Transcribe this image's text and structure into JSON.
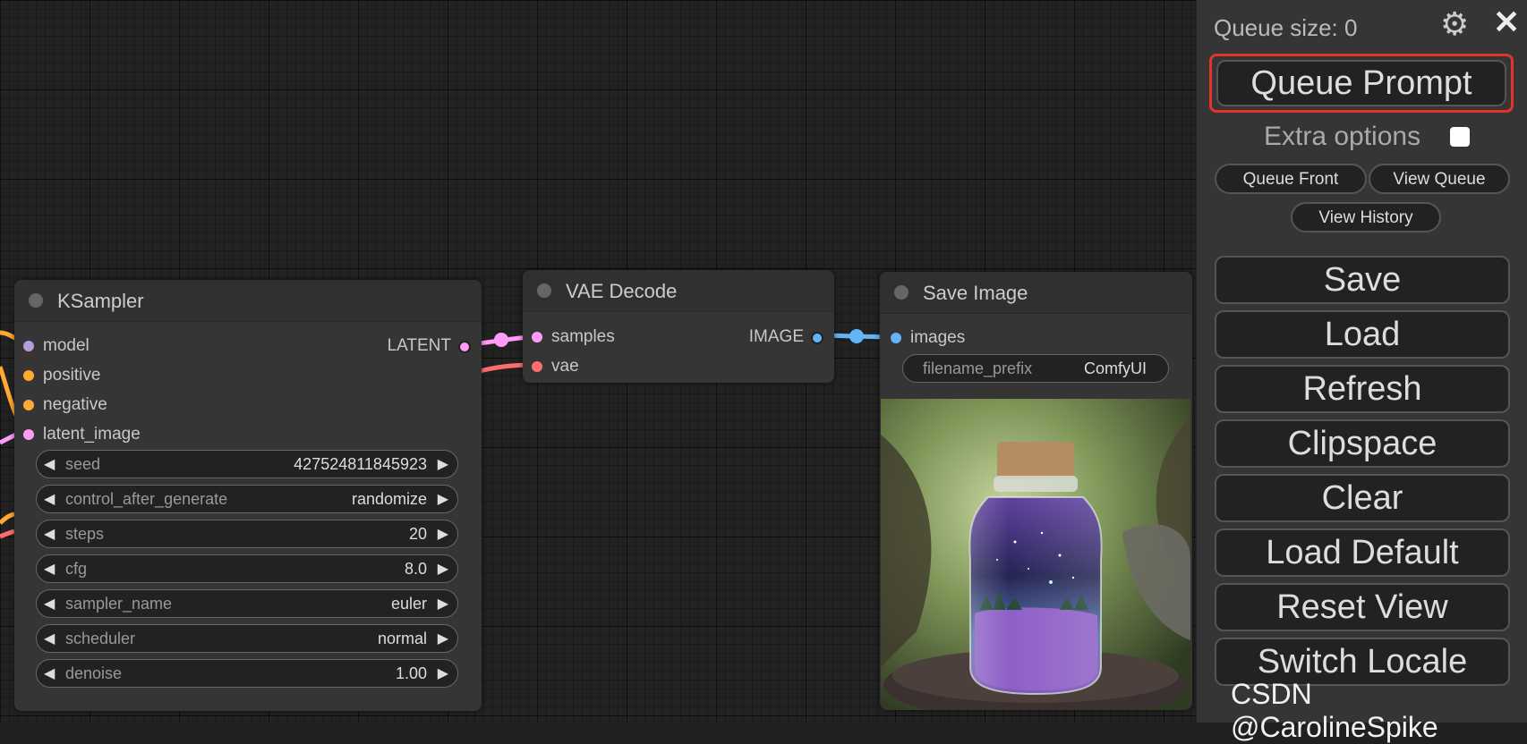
{
  "ksampler": {
    "title": "KSampler",
    "inputs": [
      "model",
      "positive",
      "negative",
      "latent_image"
    ],
    "output": "LATENT",
    "widgets": [
      {
        "label": "seed",
        "value": "427524811845923"
      },
      {
        "label": "control_after_generate",
        "value": "randomize"
      },
      {
        "label": "steps",
        "value": "20"
      },
      {
        "label": "cfg",
        "value": "8.0"
      },
      {
        "label": "sampler_name",
        "value": "euler"
      },
      {
        "label": "scheduler",
        "value": "normal"
      },
      {
        "label": "denoise",
        "value": "1.00"
      }
    ]
  },
  "vae_decode": {
    "title": "VAE Decode",
    "inputs": [
      "samples",
      "vae"
    ],
    "output": "IMAGE"
  },
  "save_image": {
    "title": "Save Image",
    "input": "images",
    "widget": {
      "label": "filename_prefix",
      "value": "ComfyUI"
    }
  },
  "menu": {
    "queue_size": "Queue size: 0",
    "queue_prompt": "Queue Prompt",
    "extra_options": "Extra options",
    "queue_front": "Queue Front",
    "view_queue": "View Queue",
    "view_history": "View History",
    "buttons": [
      "Save",
      "Load",
      "Refresh",
      "Clipspace",
      "Clear",
      "Load Default",
      "Reset View",
      "Switch Locale"
    ]
  },
  "watermark": "CSDN @CarolineSpike",
  "icons": {
    "settings": "gear-icon",
    "close": "close-icon",
    "arrows": "triangle-arrow-icon"
  },
  "colors": {
    "model": "#b39ddb",
    "conditioning": "#ffa931",
    "latent": "#ff9cf9",
    "vae": "#ff6e6e",
    "image": "#64b5f6",
    "highlight": "#e5332a"
  }
}
